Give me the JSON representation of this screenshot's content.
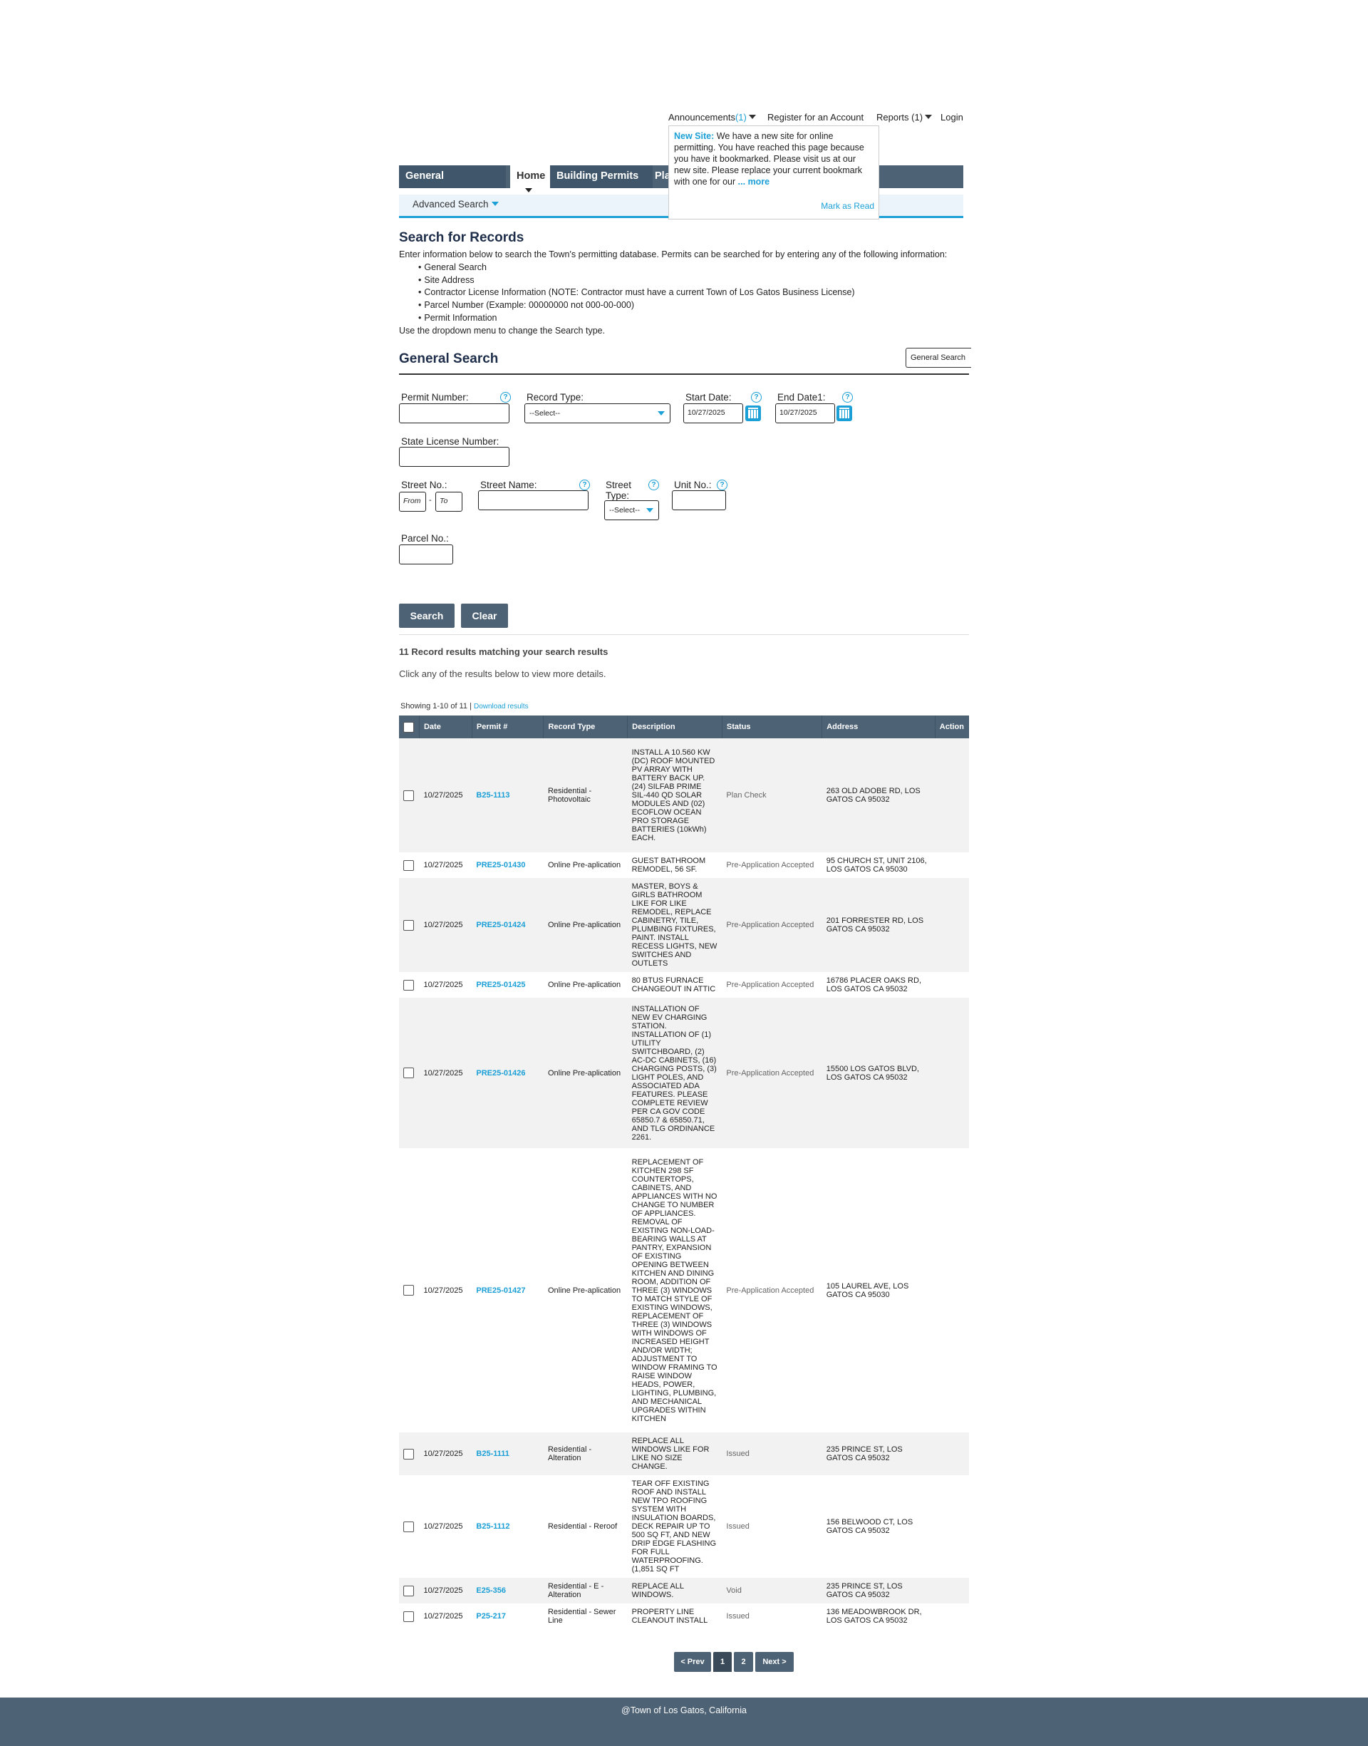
{
  "top_links": {
    "announcements": "Announcements",
    "announcements_count": "(1)",
    "register": "Register for an Account",
    "reports": "Reports (1)",
    "login": "Login"
  },
  "popup": {
    "label": "New Site:",
    "text": "We have a new site for online permitting. You have reached this page because you have it bookmarked. Please visit us at our new site. Please replace your current bookmark with one for our",
    "ellipsis": "...",
    "more": "more",
    "mark_read": "Mark as Read"
  },
  "tabs": {
    "general_info": "General Information",
    "home": "Home",
    "building_permits": "Building Permits",
    "planning": "Pla"
  },
  "subnav": {
    "advanced_search": "Advanced Search"
  },
  "intro": {
    "title": "Search for Records",
    "text": "Enter information below to search the Town's permitting database. Permits can be searched for by entering any of the following information:",
    "bullets": [
      "General Search",
      "Site Address",
      "Contractor License Information (NOTE: Contractor must have a current Town of Los Gatos Business License)",
      "Parcel Number (Example: 00000000 not 000-00-000)",
      "Permit Information"
    ],
    "footer": "Use the dropdown menu to change the Search type."
  },
  "general_search": {
    "title": "General Search",
    "type_select": "General Search"
  },
  "form": {
    "permit_number_label": "Permit Number:",
    "record_type_label": "Record Type:",
    "record_type_value": "--Select--",
    "start_date_label": "Start Date:",
    "start_date_value": "10/27/2025",
    "end_date_label": "End Date1:",
    "end_date_value": "10/27/2025",
    "state_license_label": "State License Number:",
    "street_no_label": "Street No.:",
    "from_placeholder": "From",
    "to_placeholder": "To",
    "dash": "-",
    "street_name_label": "Street Name:",
    "street_type_label_1": "Street",
    "street_type_label_2": "Type:",
    "street_type_value": "--Select--",
    "unit_no_label": "Unit No.:",
    "parcel_no_label": "Parcel No.:",
    "help_glyph": "?",
    "search_button": "Search",
    "clear_button": "Clear"
  },
  "results": {
    "summary": "11 Record results matching your search results",
    "hint": "Click any of the results below to view more details.",
    "showing": "Showing 1-10 of 11",
    "separator": "|",
    "download": "Download results",
    "columns": [
      "Date",
      "Permit #",
      "Record Type",
      "Description",
      "Status",
      "Address",
      "Action"
    ],
    "rows": [
      {
        "date": "10/27/2025",
        "permit": "B25-1113",
        "type": "Residential - Photovoltaic",
        "desc": "INSTALL A 10.560 KW (DC) ROOF MOUNTED PV ARRAY WITH BATTERY BACK UP. (24) SILFAB PRIME SIL-440 QD SOLAR MODULES AND (02) ECOFLOW OCEAN PRO STORAGE BATTERIES (10kWh) EACH.",
        "status": "Plan Check",
        "address": "263 OLD ADOBE RD, LOS GATOS CA 95032"
      },
      {
        "date": "10/27/2025",
        "permit": "PRE25-01430",
        "type": "Online Pre-aplication",
        "desc": "GUEST BATHROOM REMODEL, 56 SF.",
        "status": "Pre-Application Accepted",
        "address": "95 CHURCH ST, UNIT 2106, LOS GATOS CA 95030"
      },
      {
        "date": "10/27/2025",
        "permit": "PRE25-01424",
        "type": "Online Pre-aplication",
        "desc": "MASTER, BOYS & GIRLS BATHROOM LIKE FOR LIKE REMODEL, REPLACE CABINETRY, TILE, PLUMBING FIXTURES, PAINT. INSTALL RECESS LIGHTS, NEW SWITCHES AND OUTLETS",
        "status": "Pre-Application Accepted",
        "address": "201 FORRESTER RD, LOS GATOS CA 95032"
      },
      {
        "date": "10/27/2025",
        "permit": "PRE25-01425",
        "type": "Online Pre-aplication",
        "desc": "80 BTUS FURNACE CHANGEOUT IN ATTIC",
        "status": "Pre-Application Accepted",
        "address": "16786 PLACER OAKS RD, LOS GATOS CA 95032"
      },
      {
        "date": "10/27/2025",
        "permit": "PRE25-01426",
        "type": "Online Pre-aplication",
        "desc": "INSTALLATION OF NEW EV CHARGING STATION. INSTALLATION OF (1) UTILITY SWITCHBOARD, (2) AC-DC CABINETS, (16) CHARGING POSTS, (3) LIGHT POLES, AND ASSOCIATED ADA FEATURES. PLEASE COMPLETE REVIEW PER CA GOV CODE 65850.7 & 65850.71, AND TLG ORDINANCE 2261.",
        "status": "Pre-Application Accepted",
        "address": "15500 LOS GATOS BLVD, LOS GATOS CA 95032"
      },
      {
        "date": "10/27/2025",
        "permit": "PRE25-01427",
        "type": "Online Pre-aplication",
        "desc": "REPLACEMENT OF KITCHEN 298 SF COUNTERTOPS, CABINETS, AND APPLIANCES WITH NO CHANGE TO NUMBER OF APPLIANCES. REMOVAL OF EXISTING NON-LOAD-BEARING WALLS AT PANTRY, EXPANSION OF EXISTING OPENING BETWEEN KITCHEN AND DINING ROOM, ADDITION OF THREE (3) WINDOWS TO MATCH STYLE OF EXISTING WINDOWS, REPLACEMENT OF THREE (3) WINDOWS WITH WINDOWS OF INCREASED HEIGHT AND/OR WIDTH; ADJUSTMENT TO WINDOW FRAMING TO RAISE WINDOW HEADS, POWER, LIGHTING, PLUMBING, AND MECHANICAL UPGRADES WITHIN KITCHEN",
        "status": "Pre-Application Accepted",
        "address": "105 LAUREL AVE, LOS GATOS CA 95030"
      },
      {
        "date": "10/27/2025",
        "permit": "B25-1111",
        "type": "Residential - Alteration",
        "desc": "REPLACE ALL WINDOWS LIKE FOR LIKE NO SIZE CHANGE.",
        "status": "Issued",
        "address": "235 PRINCE ST, LOS GATOS CA 95032"
      },
      {
        "date": "10/27/2025",
        "permit": "B25-1112",
        "type": "Residential - Reroof",
        "desc": "TEAR OFF EXISTING ROOF AND INSTALL NEW TPO ROOFING SYSTEM WITH INSULATION BOARDS, DECK REPAIR UP TO 500 SQ FT, AND NEW DRIP EDGE FLASHING FOR FULL WATERPROOFING. (1,851 SQ FT",
        "status": "Issued",
        "address": "156 BELWOOD CT, LOS GATOS CA 95032"
      },
      {
        "date": "10/27/2025",
        "permit": "E25-356",
        "type": "Residential - E - Alteration",
        "desc": "REPLACE ALL WINDOWS.",
        "status": "Void",
        "address": "235 PRINCE ST, LOS GATOS CA 95032"
      },
      {
        "date": "10/27/2025",
        "permit": "P25-217",
        "type": "Residential - Sewer Line",
        "desc": "PROPERTY LINE CLEANOUT INSTALL",
        "status": "Issued",
        "address": "136 MEADOWBROOK DR, LOS GATOS CA 95032"
      }
    ]
  },
  "pager": {
    "prev": "< Prev",
    "page1": "1",
    "page2": "2",
    "next": "Next >"
  },
  "footer": {
    "text": "@Town of Los Gatos, California"
  }
}
